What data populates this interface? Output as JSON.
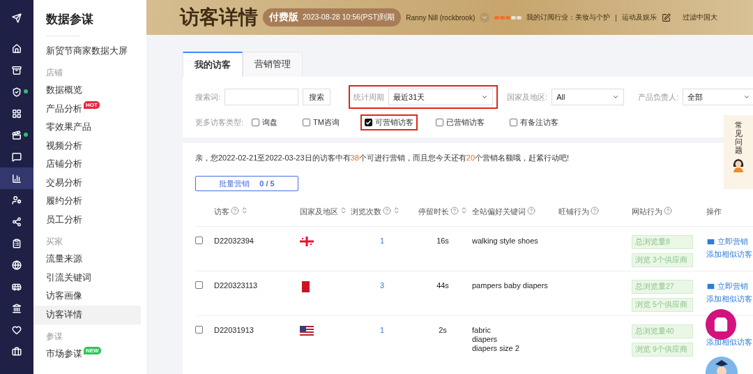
{
  "rail": [
    {
      "selected": false,
      "dot": false
    },
    {
      "selected": false,
      "dot": false
    },
    {
      "selected": false,
      "dot": false
    },
    {
      "selected": false,
      "dot": true
    },
    {
      "selected": false,
      "dot": false
    },
    {
      "selected": false,
      "dot": true
    },
    {
      "selected": false,
      "dot": false
    },
    {
      "selected": true,
      "dot": false
    },
    {
      "selected": false,
      "dot": false
    },
    {
      "selected": false,
      "dot": false
    },
    {
      "selected": false,
      "dot": false
    },
    {
      "selected": false,
      "dot": false
    },
    {
      "selected": false,
      "dot": false
    },
    {
      "selected": false,
      "dot": false
    },
    {
      "selected": false,
      "dot": false
    },
    {
      "selected": false,
      "dot": false
    }
  ],
  "sidebar": {
    "title": "数据参谋",
    "items": [
      {
        "kind": "item",
        "label": "新贸节商家数据大屏",
        "selected": false
      },
      {
        "kind": "section",
        "label": "店铺"
      },
      {
        "kind": "item",
        "label": "数据概览",
        "selected": false
      },
      {
        "kind": "item",
        "label": "产品分析",
        "selected": false,
        "badge": "HOT"
      },
      {
        "kind": "item",
        "label": "零效果产品",
        "selected": false
      },
      {
        "kind": "item",
        "label": "视频分析",
        "selected": false
      },
      {
        "kind": "item",
        "label": "店铺分析",
        "selected": false
      },
      {
        "kind": "item",
        "label": "交易分析",
        "selected": false
      },
      {
        "kind": "item",
        "label": "履约分析",
        "selected": false
      },
      {
        "kind": "item",
        "label": "员工分析",
        "selected": false
      },
      {
        "kind": "section",
        "label": "买家"
      },
      {
        "kind": "item",
        "label": "流量来源",
        "selected": false
      },
      {
        "kind": "item",
        "label": "引流关键词",
        "selected": false
      },
      {
        "kind": "item",
        "label": "访客画像",
        "selected": false
      },
      {
        "kind": "item",
        "label": "访客详情",
        "selected": true
      },
      {
        "kind": "section",
        "label": "参谋"
      },
      {
        "kind": "item",
        "label": "市场参谋",
        "selected": false,
        "badge": "NEW"
      }
    ]
  },
  "header": {
    "title": "访客详情",
    "plan": "付费版",
    "expiry": "2023-08-28 10:56(PST)到期",
    "user": "Ranny Nill (rockbrook)",
    "rating": [
      true,
      true,
      true,
      false,
      false
    ],
    "industry": "我的订阅行业：美妆与个护",
    "separator": "|",
    "category": "运动及娱乐",
    "filter_link": "过滤中国大"
  },
  "tabs": [
    {
      "label": "我的访客",
      "selected": true
    },
    {
      "label": "营销管理",
      "selected": false
    }
  ],
  "filters": {
    "search_label": "搜索词:",
    "search_button": "搜索",
    "selects": [
      {
        "label": "统计周期",
        "value": "最近31天",
        "highlighted": true
      },
      {
        "label": "国家及地区:",
        "value": "All",
        "highlighted": false
      },
      {
        "label": "产品负责人:",
        "value": "全部",
        "highlighted": false
      }
    ],
    "types_label": "更多访客类型:",
    "types": [
      {
        "label": "询盘",
        "checked": false,
        "highlighted": false
      },
      {
        "label": "TM咨询",
        "checked": false,
        "highlighted": false
      },
      {
        "label": "可营销访客",
        "checked": true,
        "highlighted": true
      },
      {
        "label": "已营销访客",
        "checked": false,
        "highlighted": false
      },
      {
        "label": "有备注访客",
        "checked": false,
        "highlighted": false
      }
    ]
  },
  "notice": {
    "before": "亲，您2022-02-21至2022-03-23日的访客中有",
    "count": "38",
    "middle": "个可进行营销，而且您今天还有",
    "quota": "20",
    "after": "个营销名额哦，赶紧行动吧!"
  },
  "bulk_button": {
    "label": "批量营销",
    "count": "0 / 5"
  },
  "table": {
    "columns": [
      {
        "label": "访客",
        "help": true,
        "sort": true
      },
      {
        "label": "国家及地区",
        "help": false,
        "sort": true
      },
      {
        "label": "浏览次数",
        "help": true,
        "sort": true
      },
      {
        "label": "停留时长",
        "help": true,
        "sort": true
      },
      {
        "label": "全站偏好关键词",
        "help": true,
        "sort": false
      },
      {
        "label": "旺铺行为",
        "help": true,
        "sort": false
      },
      {
        "label": "网站行为",
        "help": true,
        "sort": false
      },
      {
        "label": "操作",
        "help": false,
        "sort": false
      }
    ],
    "rows": [
      {
        "selected": false,
        "visitor": "D22032394",
        "views": "1",
        "duration": "16s",
        "keywords": [
          "walking style shoes"
        ],
        "site": [
          "总浏览量8",
          "浏览 3个供应商"
        ],
        "market": "立即营销",
        "similar": "添加相似访客"
      },
      {
        "selected": false,
        "visitor": "D220323113",
        "views": "3",
        "duration": "44s",
        "keywords": [
          "pampers baby diapers"
        ],
        "site": [
          "总浏览量27",
          "浏览 5个供应商"
        ],
        "market": "立即营销",
        "similar": "添加相似访客"
      },
      {
        "selected": false,
        "visitor": "D22031913",
        "views": "1",
        "duration": "2s",
        "keywords": [
          "fabric",
          "diapers",
          "diapers size 2"
        ],
        "site": [
          "总浏览量40",
          "浏览 9个供应商"
        ],
        "similar": "添加相似访客"
      }
    ]
  },
  "faq": {
    "label": "常见问题"
  }
}
